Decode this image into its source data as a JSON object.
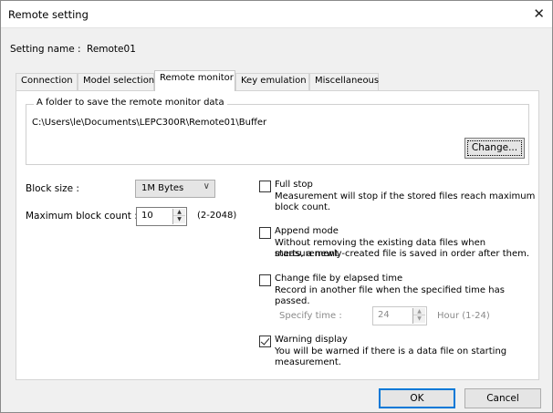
{
  "window": {
    "title": "Remote setting",
    "close_glyph": "✕"
  },
  "setting_name": {
    "label": "Setting name :",
    "value": "Remote01"
  },
  "tabs": [
    {
      "label": "Connection",
      "active": false
    },
    {
      "label": "Model selection",
      "active": false
    },
    {
      "label": "Remote monitor",
      "active": true
    },
    {
      "label": "Key emulation",
      "active": false
    },
    {
      "label": "Miscellaneous",
      "active": false
    }
  ],
  "folder_group": {
    "legend": "A folder to save the remote monitor data",
    "path": "C:\\Users\\le\\Documents\\LEPC300R\\Remote01\\Buffer",
    "change_button": "Change..."
  },
  "block_size": {
    "label": "Block size :",
    "value": "1M Bytes"
  },
  "max_block_count": {
    "label": "Maximum block count :",
    "value": "10",
    "range": "(2-2048)"
  },
  "options": {
    "full_stop": {
      "label": "Full stop",
      "checked": false,
      "desc1": "Measurement will stop if the stored files reach maximum",
      "desc2": "block count."
    },
    "append_mode": {
      "label": "Append mode",
      "checked": false,
      "desc1": "Without removing the existing data files when measurement",
      "desc2": "starts, a newly-created file is saved in order after them."
    },
    "change_file": {
      "label": "Change file by elapsed time",
      "checked": false,
      "desc1": "Record in another file when the specified time has passed.",
      "specify_label": "Specify time :",
      "specify_value": "24",
      "hour_range": "Hour (1-24)"
    },
    "warning_display": {
      "label": "Warning display",
      "checked": true,
      "desc1": "You will be warned if there is a data file on starting",
      "desc2": "measurement."
    }
  },
  "buttons": {
    "ok": "OK",
    "cancel": "Cancel"
  }
}
